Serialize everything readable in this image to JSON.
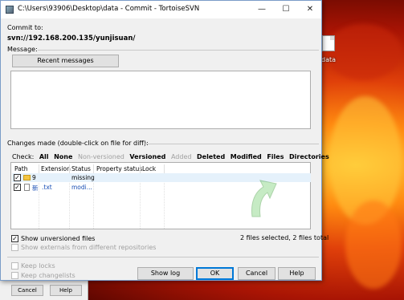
{
  "window": {
    "title": "C:\\Users\\93906\\Desktop\\data - Commit - TortoiseSVN",
    "controls": {
      "minimize": "—",
      "maximize": "☐",
      "close": "✕"
    }
  },
  "commit": {
    "label": "Commit to:",
    "url": "svn://192.168.200.135/yunjisuan/"
  },
  "message": {
    "label": "Message:",
    "recent_button": "Recent messages",
    "text": ""
  },
  "changes": {
    "label": "Changes made (double-click on file for diff):",
    "check_label": "Check:",
    "filters": [
      "All",
      "None",
      "Non-versioned",
      "Versioned",
      "Added",
      "Deleted",
      "Modified",
      "Files",
      "Directories"
    ],
    "columns": [
      "Path",
      "Extension",
      "Status",
      "Property status",
      "Lock"
    ],
    "rows": [
      {
        "path": "9",
        "extension": "",
        "status": "missing",
        "property_status": "",
        "lock": "",
        "checked": true
      },
      {
        "path": "新",
        "extension": ".txt",
        "status": "modi...",
        "property_status": "",
        "lock": "",
        "checked": true
      }
    ],
    "summary": "2 files selected, 2 files total"
  },
  "options": {
    "show_unversioned": "Show unversioned files",
    "show_externals": "Show externals from different repositories",
    "keep_locks": "Keep locks",
    "keep_changelists": "Keep changelists"
  },
  "buttons": {
    "show_log": "Show log",
    "ok": "OK",
    "cancel": "Cancel",
    "help": "Help"
  },
  "background": {
    "desktop_icon_label": "data",
    "back_window_buttons": [
      "Cancel",
      "Help"
    ]
  }
}
